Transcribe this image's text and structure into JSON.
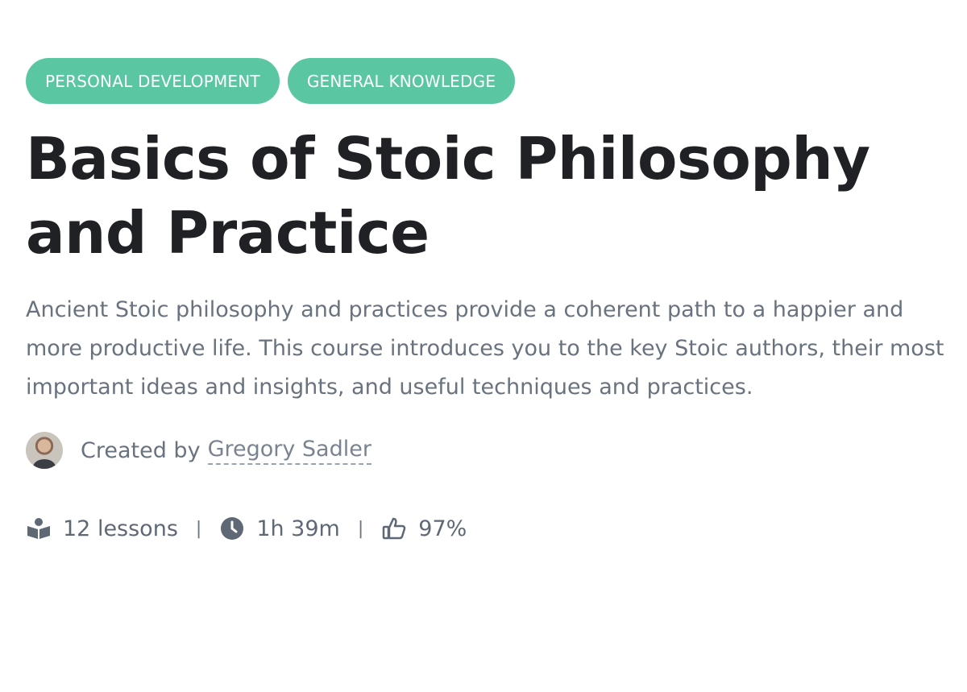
{
  "tags": [
    {
      "label": "PERSONAL DEVELOPMENT"
    },
    {
      "label": "GENERAL KNOWLEDGE"
    }
  ],
  "course": {
    "title": "Basics of Stoic Philosophy and Practice",
    "description": "Ancient Stoic philosophy and practices provide a coherent path to a happier and more productive life. This course introduces you to the key Stoic authors, their most important ideas and insights, and useful techniques and practices."
  },
  "author": {
    "created_by_label": "Created by",
    "name": "Gregory Sadler"
  },
  "stats": {
    "lessons": "12 lessons",
    "duration": "1h 39m",
    "rating": "97%",
    "separator": "|"
  },
  "icons": {
    "lessons": "book-reader-icon",
    "duration": "clock-icon",
    "rating": "thumbs-up-icon"
  },
  "colors": {
    "tag_background": "#5ac7a2",
    "title": "#1f2124",
    "body_text": "#69737f"
  }
}
